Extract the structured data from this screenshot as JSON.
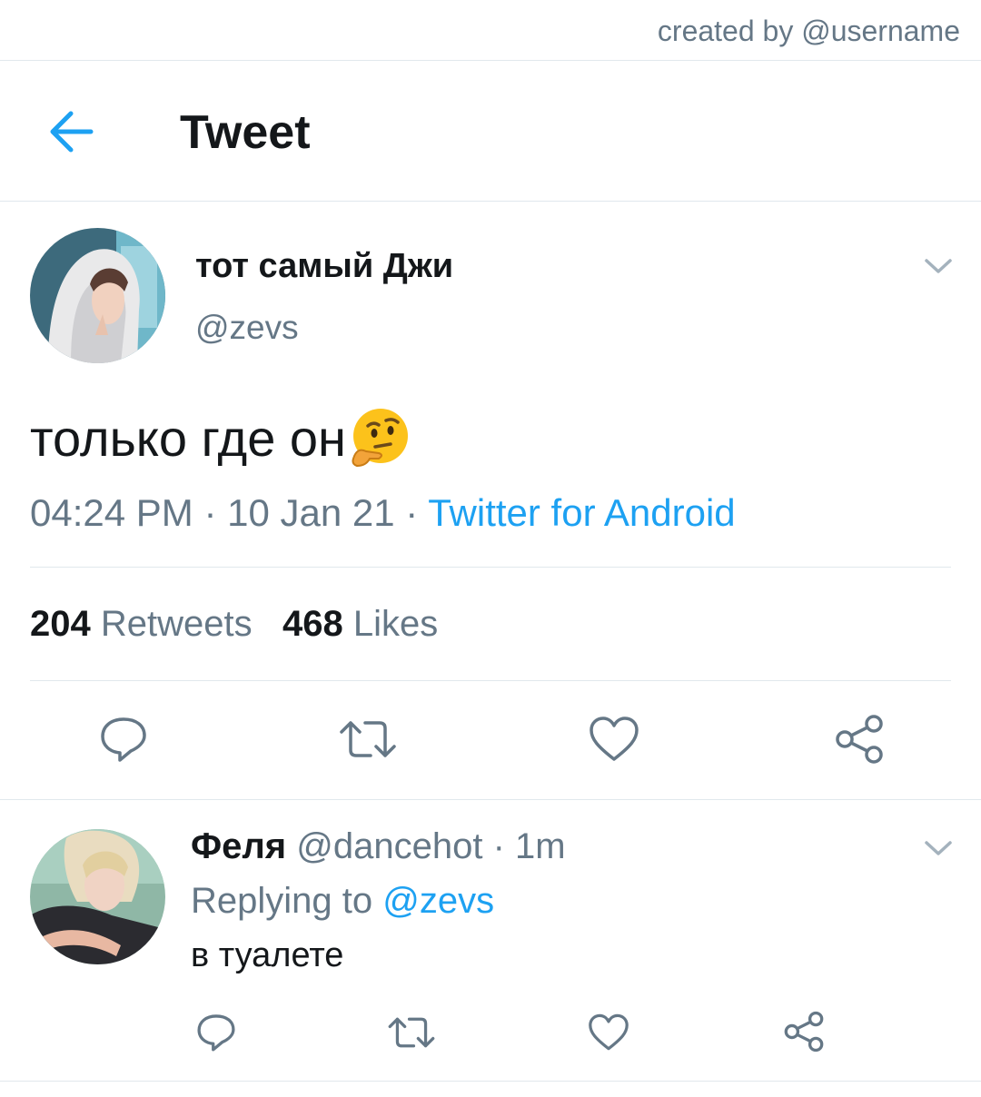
{
  "watermark": "created by @username",
  "header": {
    "title": "Tweet",
    "back_icon": "arrow-left-icon"
  },
  "tweet": {
    "display_name": "тот самый Джи",
    "handle": "@zevs",
    "text": "только где он",
    "emoji": "thinking-face-emoji",
    "time": "04:24 PM",
    "date": "10 Jan 21",
    "separator": " · ",
    "source": "Twitter for Android",
    "retweets_count": "204",
    "retweets_label": "Retweets",
    "likes_count": "468",
    "likes_label": "Likes"
  },
  "reply": {
    "name": "Феля",
    "handle": "@dancehot",
    "separator": " · ",
    "time": "1m",
    "replying_to_label": "Replying to",
    "replying_to_handle": "@zevs",
    "text": "в туалете"
  },
  "actions": [
    "reply-icon",
    "retweet-icon",
    "like-icon",
    "share-icon"
  ],
  "colors": {
    "accent": "#1da1f2",
    "secondary_text": "#657786",
    "primary_text": "#14171a",
    "divider": "#e1e8ed"
  }
}
